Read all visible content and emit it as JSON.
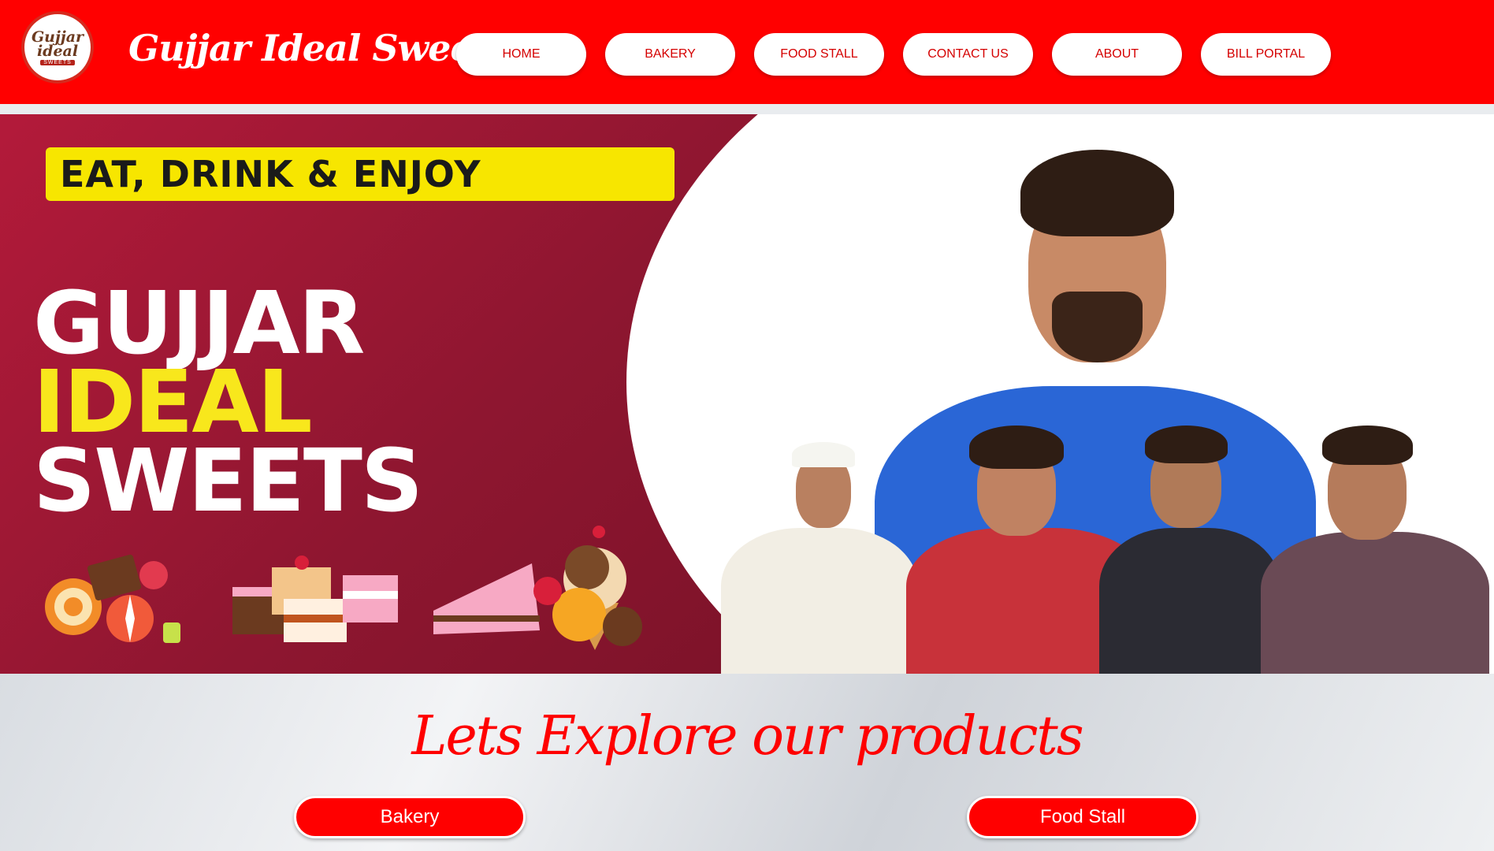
{
  "header": {
    "logo_top": "Gujjar",
    "logo_bottom": "ideal",
    "logo_tag": "SWEETS",
    "brand": "Gujjar Ideal Sweet"
  },
  "nav": {
    "items": [
      {
        "label": "HOME"
      },
      {
        "label": "BAKERY"
      },
      {
        "label": "FOOD STALL"
      },
      {
        "label": "CONTACT US"
      },
      {
        "label": "ABOUT"
      },
      {
        "label": "BILL PORTAL"
      }
    ]
  },
  "hero": {
    "tagline": "EAT, DRINK & ENJOY",
    "title_line1": "GUJJAR",
    "title_line2": "IDEAL",
    "title_line3": "SWEETS"
  },
  "explore": {
    "title": "Lets Explore our products",
    "buttons": [
      {
        "label": "Bakery"
      },
      {
        "label": "Food Stall"
      }
    ]
  },
  "colors": {
    "brand_red": "#ff0000",
    "hero_maroon": "#8e1630",
    "tagline_yellow": "#f7e600",
    "title_yellow": "#f8e71c"
  }
}
